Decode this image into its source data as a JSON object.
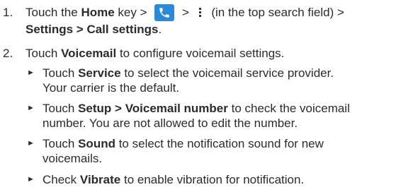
{
  "step1": {
    "num": "1.",
    "line1": {
      "pre": "Touch the ",
      "home": "Home",
      "key": " key > ",
      "gt": " > ",
      "after": " (in the top search field) >"
    },
    "line2": {
      "settings": "Settings",
      "sep": " > ",
      "call_settings": "Call settings",
      "end": "."
    }
  },
  "step2": {
    "num": "2.",
    "pre": "Touch ",
    "voicemail": "Voicemail",
    "rest": " to configure voicemail settings."
  },
  "bullets": [
    {
      "mark": "►",
      "pre": "Touch ",
      "bold": "Service",
      "rest": " to select the voicemail service provider.",
      "line2": "Your carrier is the default."
    },
    {
      "mark": "►",
      "pre": "Touch ",
      "bold": "Setup",
      "mid": " > ",
      "bold2": "Voicemail number",
      "rest": " to check the voicemail",
      "line2": "number. You are not allowed to edit the number."
    },
    {
      "mark": "►",
      "pre": "Touch ",
      "bold": "Sound",
      "rest": " to select the notification sound for new",
      "line2": "voicemails."
    },
    {
      "mark": "►",
      "pre": "Check ",
      "bold": "Vibrate",
      "rest": " to enable vibration for notification."
    }
  ],
  "icons": {
    "phone": "phone-app-icon",
    "menu": "more-options-icon",
    "phone_color": "#2a8ad8"
  }
}
